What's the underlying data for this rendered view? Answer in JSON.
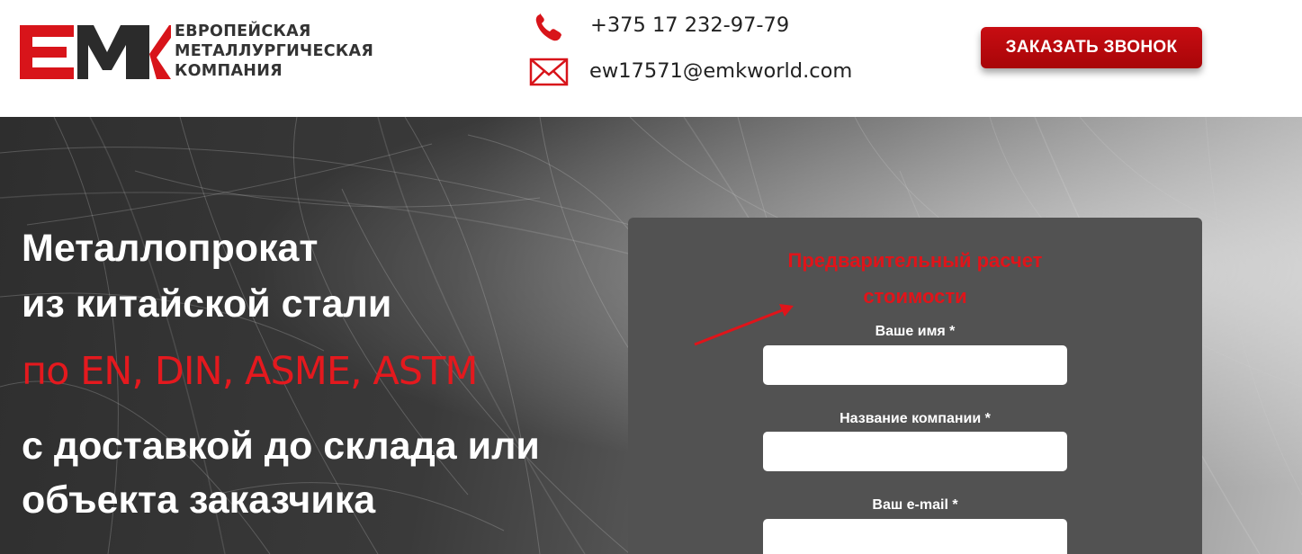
{
  "header": {
    "logo": {
      "mark": "EMK",
      "lines": [
        "ЕВРОПЕЙСКАЯ",
        "МЕТАЛЛУРГИЧЕСКАЯ",
        "КОМПАНИЯ"
      ]
    },
    "phone": "+375 17 232-97-79",
    "email": "ew17571@emkworld.com",
    "call_button_label": "ЗАКАЗАТЬ ЗВОНОК",
    "icons": {
      "phone": "phone-icon",
      "email": "envelope-icon"
    }
  },
  "hero": {
    "title_line1": "Металлопрокат",
    "title_line2": "из китайской стали",
    "title_highlight": "по EN, DIN, ASME, ASTM",
    "title_line4": "с доставкой до склада или",
    "title_line5": "объекта заказчика"
  },
  "form": {
    "heading_line1": "Предварительный расчет",
    "heading_line2": "стоимости",
    "fields": [
      {
        "label": "Ваше имя *",
        "value": "",
        "placeholder": ""
      },
      {
        "label": "Название компании *",
        "value": "",
        "placeholder": ""
      },
      {
        "label": "Ваш e-mail *",
        "value": "",
        "placeholder": ""
      }
    ]
  },
  "colors": {
    "brand_red": "#e4191e",
    "button_red": "#b80a0e",
    "form_bg": "#525252"
  }
}
